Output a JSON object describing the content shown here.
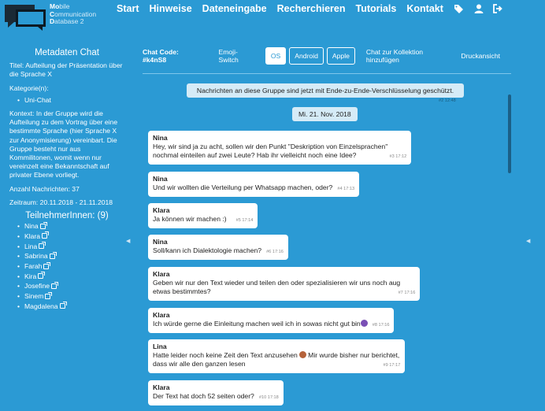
{
  "brand": {
    "line1": "Mobile",
    "line2": "Communication",
    "line3": "Database 2",
    "b1": "Mo",
    "r1": "bile",
    "b2": "C",
    "r2": "ommunication",
    "b3": "D",
    "r3": "atabase 2"
  },
  "nav": {
    "items": [
      "Start",
      "Hinweise",
      "Dateneingabe",
      "Recherchieren",
      "Tutorials",
      "Kontakt"
    ]
  },
  "sidebar": {
    "title": "Metadaten Chat",
    "titel": "Titel: Aufteilung der Präsentation über die Sprache X",
    "kategorien_label": "Kategorie(n):",
    "kategorien": [
      "Uni-Chat"
    ],
    "kontext": "Kontext: In der Gruppe wird die Aufteilung zu dem Vortrag über eine bestimmte Sprache (hier Sprache X zur Anonymisierung) vereinbart. Die Gruppe besteht nur aus Kommilitonen, womit wenn nur vereinzelt eine Bekanntschaft auf privater Ebene vorliegt.",
    "anzahl": "Anzahl Nachrichten: 37",
    "zeitraum": "Zeitraum: 20.11.2018 - 21.11.2018",
    "people_title": "TeilnehmerInnen: (9)",
    "people": [
      "Nina",
      "Klara",
      "Lina",
      "Sabrina",
      "Farah",
      "Kira",
      "Josefine",
      "Sinem",
      "Magdalena"
    ]
  },
  "toolbar": {
    "code": "Chat Code: #k4nS8",
    "emoji_switch": "Emoji-Switch",
    "os": "OS",
    "android": "Android",
    "apple": "Apple",
    "add_collection": "Chat zur Kollektion hinzufügen",
    "print": "Druckansicht"
  },
  "chat": {
    "system": "Nachrichten an diese Gruppe sind jetzt mit Ende-zu-Ende-Verschlüsselung geschützt.",
    "system_meta": "#2 12:48",
    "date": "Mi. 21. Nov. 2018",
    "messages": [
      {
        "who": "Nina",
        "text1": "Hey, wir sind ja zu acht, sollen wir den Punkt \"Deskription von Einzelsprachen\"",
        "text2": "nochmal einteilen auf zwei Leute? Hab ihr vielleicht noch eine Idee?",
        "meta": "#3 17:12"
      },
      {
        "who": "Nina",
        "text1": "Und wir wollten die Verteilung per Whatsapp machen, oder?",
        "text2": "",
        "meta": "#4 17:13"
      },
      {
        "who": "Klara",
        "text1": "Ja können wir machen :)",
        "text2": "",
        "meta": "#5 17:14"
      },
      {
        "who": "Nina",
        "text1": "Soll/kann ich Dialektologie machen?",
        "text2": "",
        "meta": "#6 17:16"
      },
      {
        "who": "Klara",
        "text1": "Geben wir nur den Text wieder und teilen den oder spezialisieren wir uns noch aug",
        "text2": "etwas bestimmtes?",
        "meta": "#7 17:16"
      },
      {
        "who": "Klara",
        "text1": "Ich würde gerne die Einleitung machen weil ich in sowas nicht gut bin",
        "text2": "",
        "meta": "#8 17:16"
      },
      {
        "who": "Lina",
        "text1": "Hatte leider noch keine Zeit den Text anzusehen",
        "text1b": " Mir wurde bisher nur berichtet,",
        "text2": "dass wir alle den ganzen lesen",
        "meta": "#9 17:17"
      },
      {
        "who": "Klara",
        "text1": "Der Text hat doch 52 seiten oder?",
        "text2": "",
        "meta": "#10 17:18"
      }
    ]
  },
  "colors": {
    "background": "#2b9ad4",
    "bubble": "#ffffff",
    "system_bubble": "#d5ebf7"
  }
}
